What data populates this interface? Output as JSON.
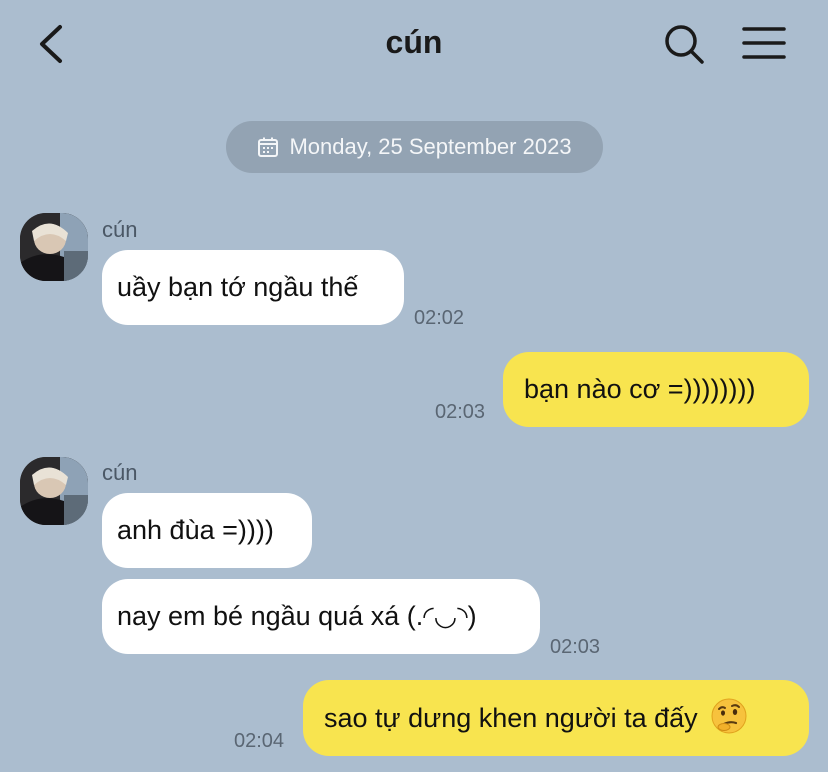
{
  "header": {
    "title": "cún",
    "back_icon": "chevron-left-icon",
    "search_icon": "search-icon",
    "menu_icon": "hamburger-menu-icon"
  },
  "date_separator": {
    "icon": "calendar-icon",
    "label": "Monday, 25 September 2023"
  },
  "messages": [
    {
      "direction": "incoming",
      "sender": "cún",
      "text": "uầy bạn tớ ngầu thế",
      "time": "02:02"
    },
    {
      "direction": "outgoing",
      "text": "bạn nào cơ =))))))))",
      "time": "02:03"
    },
    {
      "direction": "incoming",
      "sender": "cún",
      "text": "anh đùa =))))",
      "time": ""
    },
    {
      "direction": "incoming",
      "text": "nay em bé ngầu quá xá (.◜◡◝)",
      "time": "02:03"
    },
    {
      "direction": "outgoing",
      "text": "sao tự dưng khen người ta đấy",
      "emoji": "face-with-monocle-thinking-emoji",
      "time": "02:04"
    }
  ],
  "colors": {
    "background": "#abbdcf",
    "incoming_bubble": "#ffffff",
    "outgoing_bubble": "#f8e44f",
    "date_pill": "#93a3b3"
  }
}
